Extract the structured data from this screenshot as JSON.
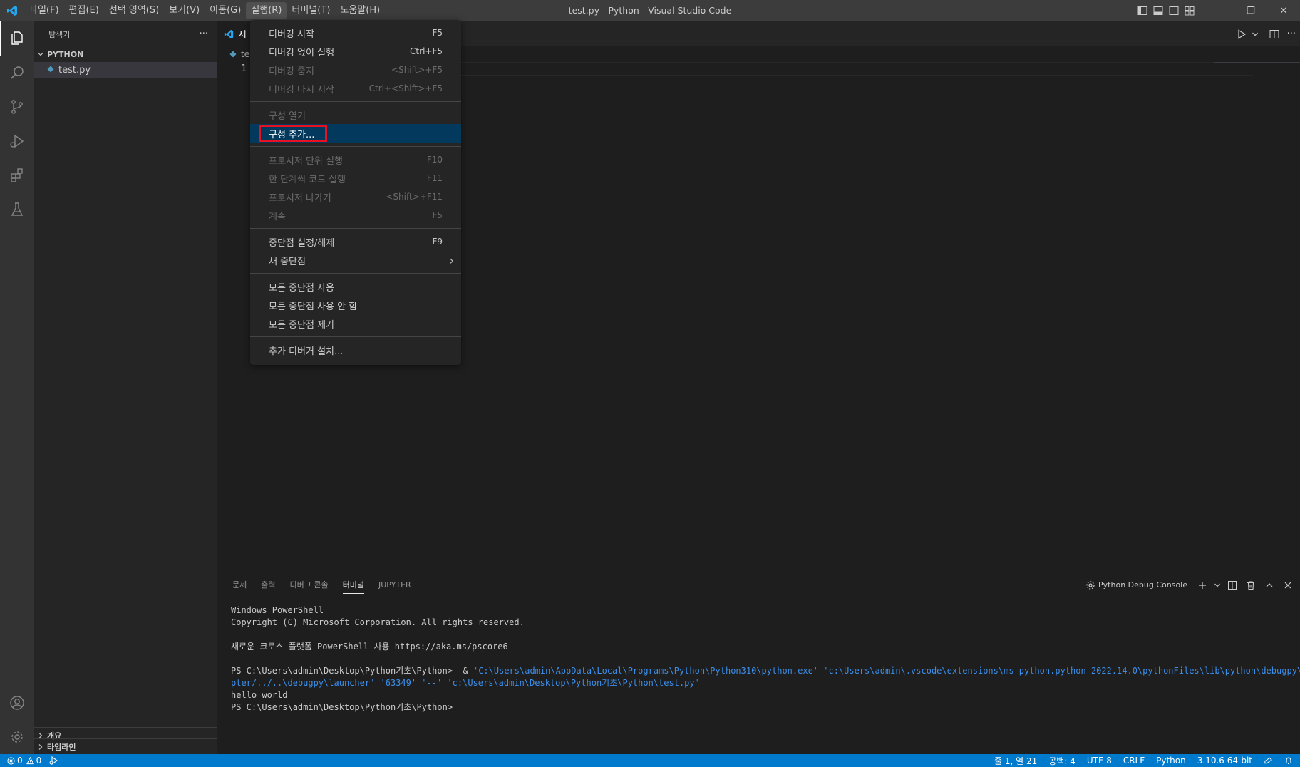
{
  "window": {
    "title": "test.py - Python - Visual Studio Code",
    "controls": {
      "minimize": "—",
      "restore": "❐",
      "close": "✕"
    }
  },
  "menubar": {
    "items": [
      "파일(F)",
      "편집(E)",
      "선택 영역(S)",
      "보기(V)",
      "이동(G)",
      "실행(R)",
      "터미널(T)",
      "도움말(H)"
    ],
    "active": "실행(R)"
  },
  "sidebar": {
    "title": "탐색기",
    "more": "···",
    "folder": "PYTHON",
    "files": [
      "test.py"
    ],
    "sections": [
      "개요",
      "타임라인"
    ]
  },
  "editor": {
    "tab_label": "시",
    "breadcrumb": "te",
    "line_numbers": [
      "1"
    ]
  },
  "run_menu": {
    "groups": [
      [
        {
          "label": "디버깅 시작",
          "shortcut": "F5",
          "enabled": true
        },
        {
          "label": "디버깅 없이 실행",
          "shortcut": "Ctrl+F5",
          "enabled": true
        },
        {
          "label": "디버깅 중지",
          "shortcut": "<Shift>+F5",
          "enabled": false
        },
        {
          "label": "디버깅 다시 시작",
          "shortcut": "Ctrl+<Shift>+F5",
          "enabled": false
        }
      ],
      [
        {
          "label": "구성 열기",
          "shortcut": "",
          "enabled": false
        },
        {
          "label": "구성 추가...",
          "shortcut": "",
          "enabled": true,
          "highlighted": true
        }
      ],
      [
        {
          "label": "프로시저 단위 실행",
          "shortcut": "F10",
          "enabled": false
        },
        {
          "label": "한 단계씩 코드 실행",
          "shortcut": "F11",
          "enabled": false
        },
        {
          "label": "프로시저 나가기",
          "shortcut": "<Shift>+F11",
          "enabled": false
        },
        {
          "label": "계속",
          "shortcut": "F5",
          "enabled": false
        }
      ],
      [
        {
          "label": "중단점 설정/해제",
          "shortcut": "F9",
          "enabled": true
        },
        {
          "label": "새 중단점",
          "shortcut": "›",
          "enabled": true
        }
      ],
      [
        {
          "label": "모든 중단점 사용",
          "shortcut": "",
          "enabled": true
        },
        {
          "label": "모든 중단점 사용 안 함",
          "shortcut": "",
          "enabled": true
        },
        {
          "label": "모든 중단점 제거",
          "shortcut": "",
          "enabled": true
        }
      ],
      [
        {
          "label": "추가 디버거 설치...",
          "shortcut": "",
          "enabled": true
        }
      ]
    ]
  },
  "panel": {
    "tabs": [
      "문제",
      "출력",
      "디버그 콘솔",
      "터미널",
      "JUPYTER"
    ],
    "active_tab": "터미널",
    "terminal_name": "Python Debug Console",
    "terminal_lines": [
      {
        "type": "text",
        "text": "Windows PowerShell"
      },
      {
        "type": "text",
        "text": "Copyright (C) Microsoft Corporation. All rights reserved."
      },
      {
        "type": "blank",
        "text": ""
      },
      {
        "type": "text",
        "text": "새로운 크로스 플랫폼 PowerShell 사용 https://aka.ms/pscore6"
      },
      {
        "type": "blank",
        "text": ""
      },
      {
        "type": "cmd",
        "prompt": "PS C:\\Users\\admin\\Desktop\\Python기초\\Python>  & ",
        "rest": "'C:\\Users\\admin\\AppData\\Local\\Programs\\Python\\Python310\\python.exe' 'c:\\Users\\admin\\.vscode\\extensions\\ms-python.python-2022.14.0\\pythonFiles\\lib\\python\\debugpy\\ada"
      },
      {
        "type": "str",
        "text": "pter/../..\\debugpy\\launcher' '63349' '--' 'c:\\Users\\admin\\Desktop\\Python기초\\Python\\test.py'"
      },
      {
        "type": "text",
        "text": "hello world"
      },
      {
        "type": "text",
        "text": "PS C:\\Users\\admin\\Desktop\\Python기초\\Python>"
      }
    ]
  },
  "statusbar": {
    "errors": "0",
    "warnings": "0",
    "position": "줄 1, 열 21",
    "spaces": "공백: 4",
    "encoding": "UTF-8",
    "eol": "CRLF",
    "language": "Python",
    "interpreter": "3.10.6 64-bit"
  },
  "colors": {
    "accent": "#007acc",
    "menu_highlight": "#04395e",
    "callout_box": "#e81123",
    "terminal_string": "#3b8eea"
  }
}
